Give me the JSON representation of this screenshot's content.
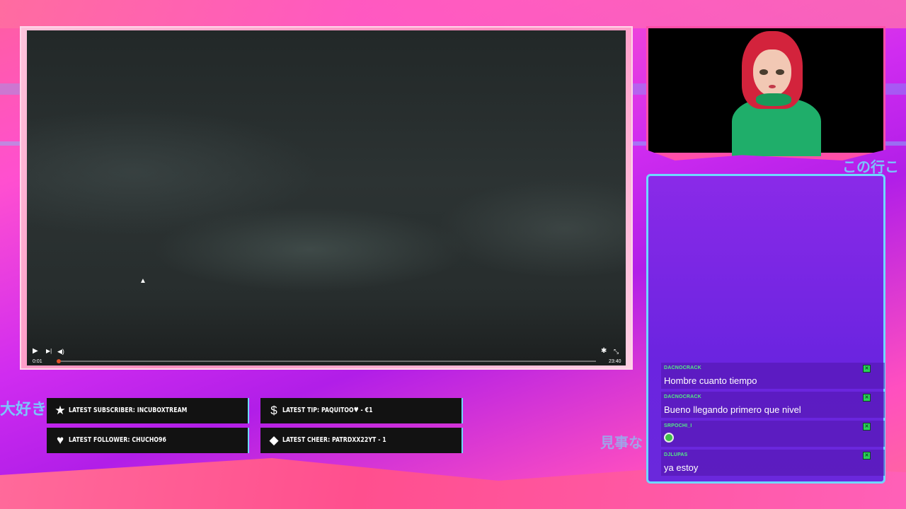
{
  "player": {
    "current_time": "0:01",
    "duration": "23:40",
    "progress_fraction": 0.0007,
    "icons": {
      "play": "play-icon",
      "next": "skip-next-icon",
      "volume": "volume-icon",
      "settings": "gear-icon",
      "fullscreen": "fullscreen-icon"
    }
  },
  "decor_text": {
    "left": "大好き",
    "right_top": "この行こ",
    "right_bottom": "見事な"
  },
  "alerts": [
    {
      "icon": "star-icon",
      "text": "LATEST SUBSCRIBER: INCUBOXTREAM"
    },
    {
      "icon": "dollar-icon",
      "text": "LATEST TIP: PAQUITOO♥ - €1"
    },
    {
      "icon": "heart-icon",
      "text": "LATEST FOLLOWER: CHUCHO96"
    },
    {
      "icon": "diamond-icon",
      "text": "LATEST CHEER: PATRDXX22YT - 1"
    }
  ],
  "chat": {
    "messages": [
      {
        "user": "DACNOCRACK",
        "text": "Hombre cuanto tiempo"
      },
      {
        "user": "DACNOCRACK",
        "text": "Bueno llegando primero que nivel"
      },
      {
        "user": "SRPOCHI_I",
        "text": ""
      },
      {
        "user": "DJLUPAS",
        "text": "ya estoy"
      }
    ]
  },
  "colors": {
    "accent_cyan": "#6fd8ff",
    "chat_username": "#54e888",
    "progress_knob": "#e0502a",
    "alert_bg": "#121212"
  }
}
